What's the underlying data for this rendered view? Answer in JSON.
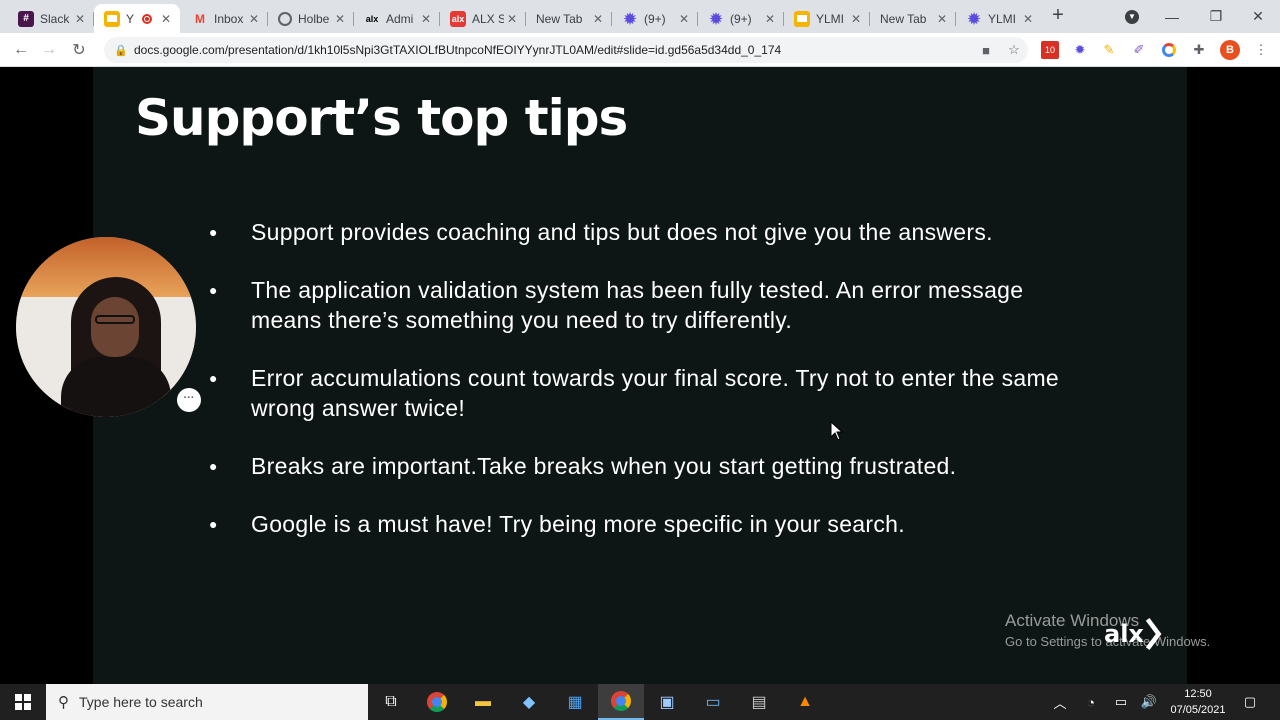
{
  "browser": {
    "tabs": [
      {
        "title": "Slack",
        "icon": "slack-icon",
        "color": "#4a154b"
      },
      {
        "title": "Y",
        "icon": "slides-icon",
        "color": "#f4b400",
        "recording": true
      },
      {
        "title": "Inbox",
        "icon": "gmail-icon",
        "color": "#ea4335"
      },
      {
        "title": "Holbe",
        "icon": "globe-icon",
        "color": "#5f6368"
      },
      {
        "title": "Admi",
        "icon": "alx-icon",
        "color": "#000000"
      },
      {
        "title": "ALX S",
        "icon": "alx-red-icon",
        "color": "#e53935"
      },
      {
        "title": "New Tab",
        "icon": "none",
        "color": "#5f6368"
      },
      {
        "title": "(9+)",
        "icon": "gear-purple-icon",
        "color": "#5b4ce0"
      },
      {
        "title": "(9+)",
        "icon": "gear-purple-icon",
        "color": "#5b4ce0"
      },
      {
        "title": "YLMI",
        "icon": "slides-icon",
        "color": "#f4b400"
      },
      {
        "title": "New Tab",
        "icon": "none",
        "color": "#5f6368"
      },
      {
        "title": "YLMI",
        "icon": "gear-purple-icon",
        "color": "#5b4ce0"
      }
    ],
    "url": "docs.google.com/presentation/d/1kh10l5sNpi3GtTAXIOLfBUtnpcoNfEOIYYynrJTL0AM/edit#slide=id.gd56a5d34dd_0_174",
    "extension_badge": "10",
    "profile_initial": "B"
  },
  "slide": {
    "title": "Support’s top tips",
    "bullets": [
      "Support provides coaching and tips but does not give you the answers.",
      "The application validation system has been fully tested. An error message means there’s something you need to try differently.",
      "Error accumulations count towards your final score. Try not to enter the same wrong answer twice!",
      "Breaks are important.Take breaks when you start getting frustrated.",
      "Google is a must have! Try being more specific in your search."
    ]
  },
  "webcam": {
    "more_label": "···"
  },
  "watermark": {
    "line1": "Activate Windows",
    "line2": "Go to Settings to activate Windows.",
    "logo_text": "alx"
  },
  "taskbar": {
    "search_placeholder": "Type here to search",
    "time": "12:50",
    "date": "07/05/2021"
  },
  "colors": {
    "slide_bg": "#0d1614",
    "tabstrip": "#dee1e6",
    "taskbar": "#202020"
  }
}
